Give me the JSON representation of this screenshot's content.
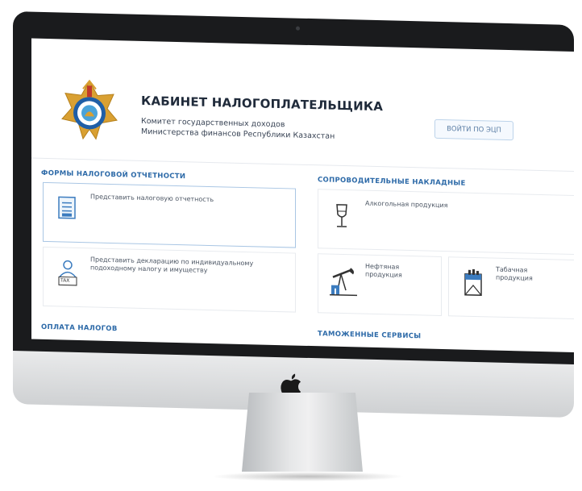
{
  "header": {
    "title": "КАБИНЕТ НАЛОГОПЛАТЕЛЬЩИКА",
    "subtitle_line1": "Комитет государственных доходов",
    "subtitle_line2": "Министерства финансов Республики Казахстан",
    "login_button": "ВОЙТИ ПО ЭЦП"
  },
  "sections": {
    "tax_forms": {
      "heading": "ФОРМЫ НАЛОГОВОЙ ОТЧЕТНОСТИ",
      "cards": [
        {
          "label": "Представить налоговую отчетность"
        },
        {
          "label_line1": "Представить декларацию по индивидуальному",
          "label_line2": "подоходному налогу и имуществу",
          "icon_text": "TAX"
        }
      ]
    },
    "waybills": {
      "heading": "СОПРОВОДИТЕЛЬНЫЕ НАКЛАДНЫЕ",
      "cards": [
        {
          "label": "Алкогольная продукция"
        },
        {
          "label_line1": "Нефтяная",
          "label_line2": "продукция"
        },
        {
          "label_line1": "Табачная",
          "label_line2": "продукция"
        }
      ]
    },
    "tax_payment": {
      "heading": "ОПЛАТА НАЛОГОВ"
    },
    "customs": {
      "heading": "ТАМОЖЕННЫЕ СЕРВИСЫ"
    }
  },
  "colors": {
    "accent": "#2d6aa8",
    "active_border": "#a9c6e4",
    "title": "#1f2a3a"
  },
  "icons": [
    "emblem-icon",
    "document-icon",
    "user-tax-icon",
    "wine-glass-icon",
    "oil-rig-icon",
    "cigarette-pack-icon",
    "apple-logo-icon"
  ]
}
